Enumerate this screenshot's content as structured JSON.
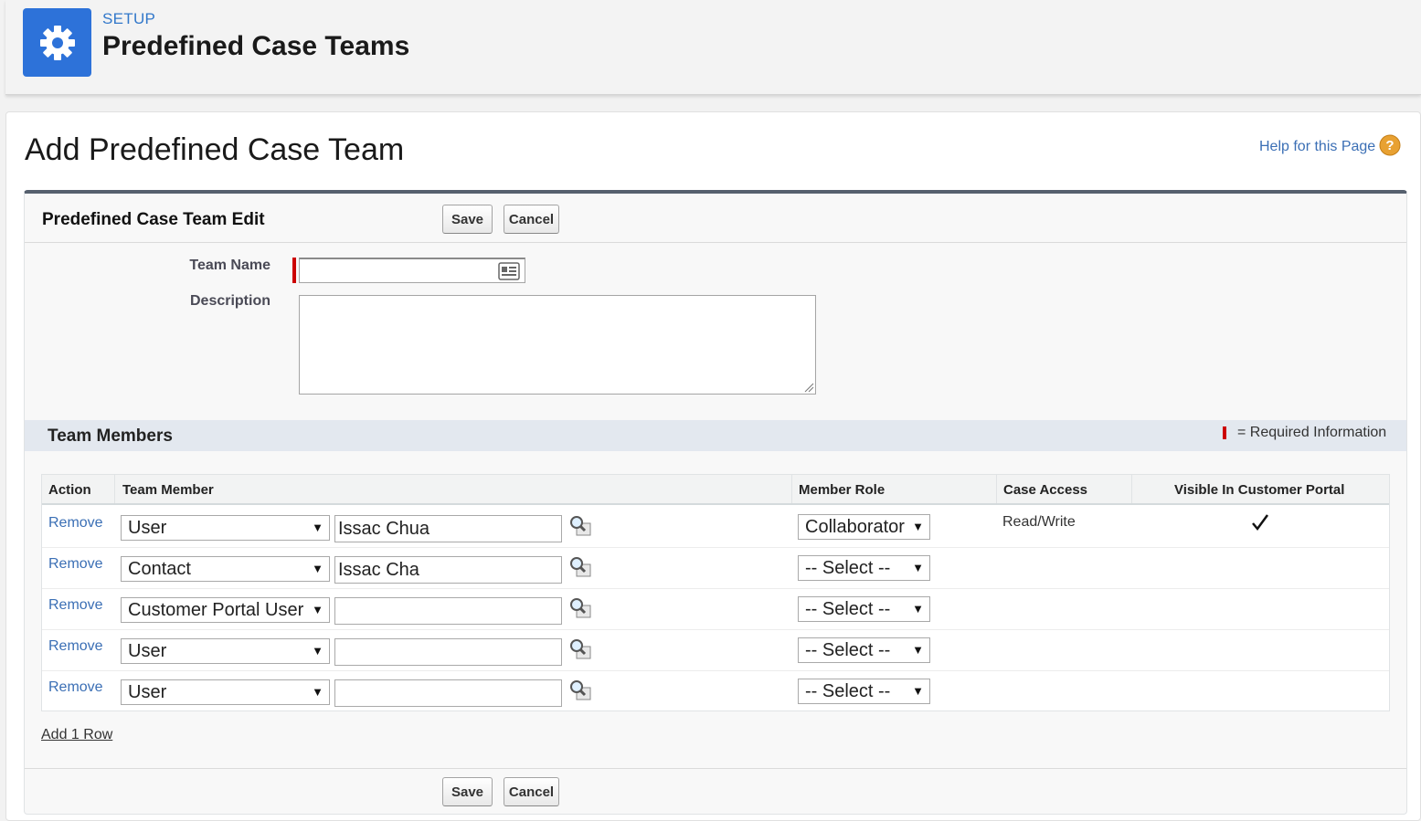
{
  "header": {
    "section": "SETUP",
    "title": "Predefined Case Teams",
    "icon": "gear-icon",
    "accent": "#2d72d9"
  },
  "page": {
    "title": "Add Predefined Case Team",
    "help_link": "Help for this Page",
    "help_icon": "help-circle-icon"
  },
  "edit_block": {
    "title": "Predefined Case Team Edit",
    "save_label": "Save",
    "cancel_label": "Cancel",
    "fields": {
      "team_name_label": "Team Name",
      "team_name_value": "",
      "description_label": "Description",
      "description_value": ""
    }
  },
  "team_members": {
    "title": "Team Members",
    "required_legend": "= Required Information",
    "columns": {
      "action": "Action",
      "team_member": "Team Member",
      "member_role": "Member Role",
      "case_access": "Case Access",
      "visible": "Visible In Customer Portal"
    },
    "rows": [
      {
        "action": "Remove",
        "type": "User",
        "member": "Issac Chua",
        "role": "Collaborator",
        "access": "Read/Write",
        "visible": true
      },
      {
        "action": "Remove",
        "type": "Contact",
        "member": "Issac Cha",
        "role": "-- Select --",
        "access": "",
        "visible": false
      },
      {
        "action": "Remove",
        "type": "Customer Portal User",
        "member": "",
        "role": "-- Select --",
        "access": "",
        "visible": false
      },
      {
        "action": "Remove",
        "type": "User",
        "member": "",
        "role": "-- Select --",
        "access": "",
        "visible": false
      },
      {
        "action": "Remove",
        "type": "User",
        "member": "",
        "role": "-- Select --",
        "access": "",
        "visible": false
      }
    ],
    "add_row": "Add 1 Row"
  },
  "colors": {
    "link": "#3b6fb5",
    "required": "#cc0000",
    "section_bg": "#e3e8ef"
  }
}
